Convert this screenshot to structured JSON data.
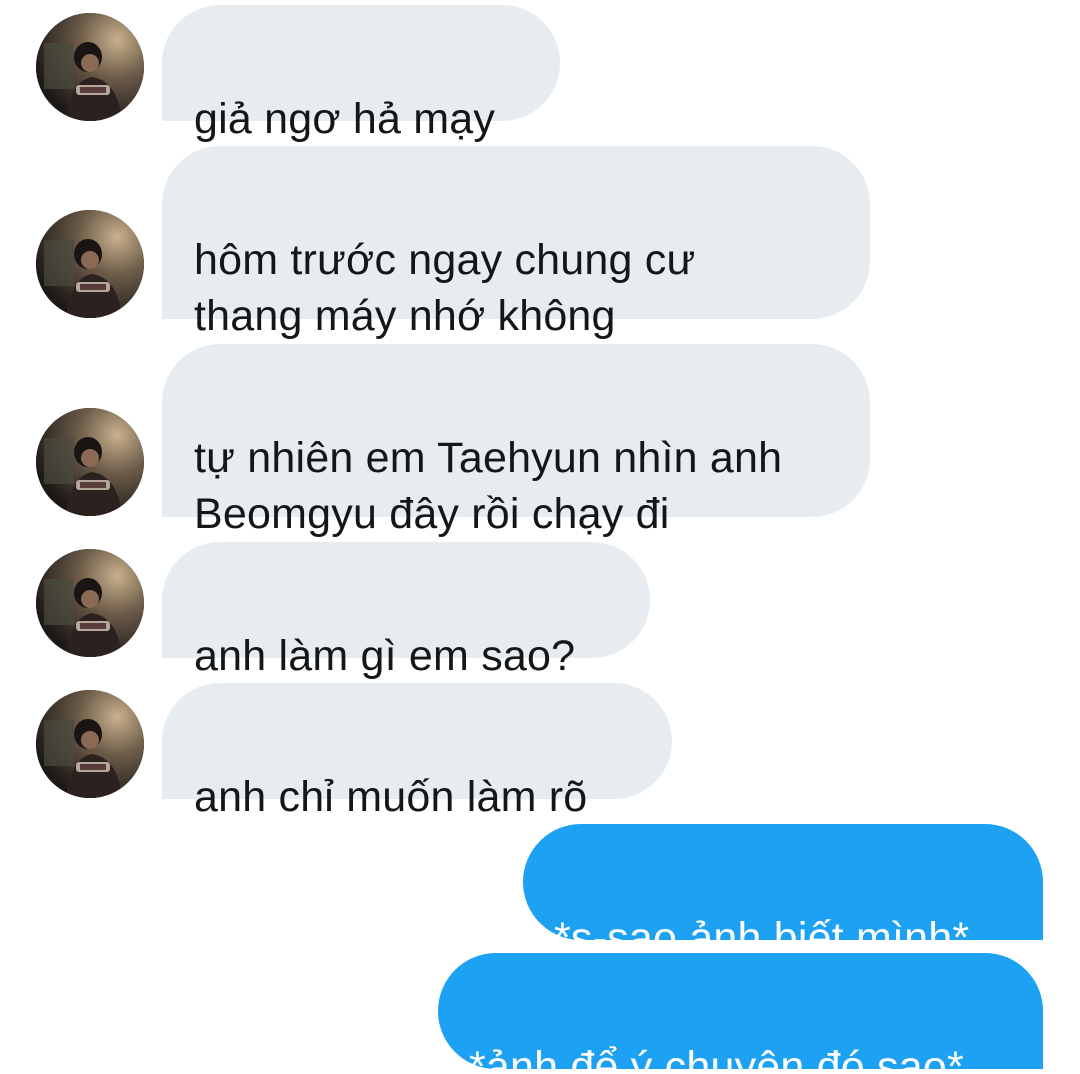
{
  "colors": {
    "incoming_bubble": "#e6ecf0",
    "incoming_text": "#14171a",
    "outgoing_bubble": "#1da1f2",
    "outgoing_text": "#ffffff",
    "background": "#ffffff"
  },
  "messages": [
    {
      "direction": "incoming",
      "text": "giả ngơ hả mạy",
      "avatar": "contact-avatar"
    },
    {
      "direction": "incoming",
      "text": "hôm trước ngay chung cư\nthang máy nhớ không",
      "avatar": "contact-avatar"
    },
    {
      "direction": "incoming",
      "text": "tự nhiên em Taehyun nhìn anh\nBeomgyu đây rồi chạy đi",
      "avatar": "contact-avatar"
    },
    {
      "direction": "incoming",
      "text": "anh làm gì em sao?",
      "avatar": "contact-avatar"
    },
    {
      "direction": "incoming",
      "text": "anh chỉ muốn làm rõ",
      "avatar": "contact-avatar"
    },
    {
      "direction": "outgoing",
      "text": "*s-sao ảnh biết mình*"
    },
    {
      "direction": "outgoing",
      "text": "*ảnh để ý chuyện đó sao*"
    }
  ]
}
